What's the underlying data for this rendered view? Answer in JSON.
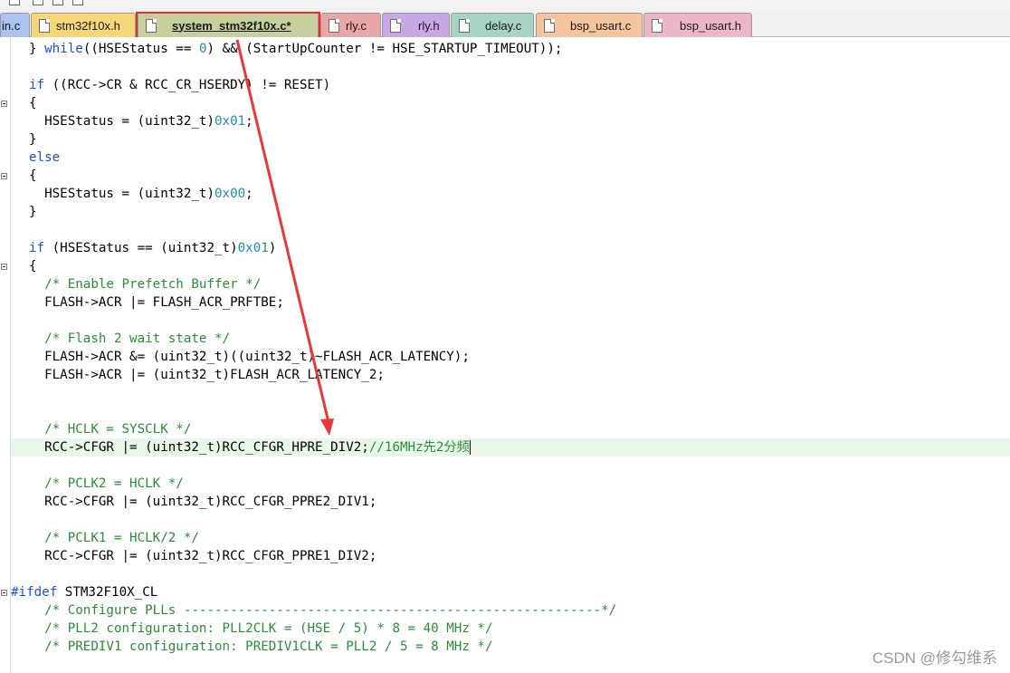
{
  "tabs": [
    {
      "label": "in.c",
      "color": "#a9c4f0",
      "active": false
    },
    {
      "label": "stm32f10x.h",
      "color": "#f6d777",
      "active": false
    },
    {
      "label": "system_stm32f10x.c*",
      "color": "#c9cf9c",
      "active": true
    },
    {
      "label": "rly.c",
      "color": "#e9a6a6",
      "active": false
    },
    {
      "label": "rly.h",
      "color": "#c9a6e6",
      "active": false
    },
    {
      "label": "delay.c",
      "color": "#a6d3c3",
      "active": false
    },
    {
      "label": "bsp_usart.c",
      "color": "#f6c49c",
      "active": false
    },
    {
      "label": "bsp_usart.h",
      "color": "#ecb6c6",
      "active": false
    }
  ],
  "editor": {
    "current_line_color": "#e8f8e8",
    "lines": [
      [
        {
          "t": "} "
        },
        {
          "t": "while",
          "c": "kw"
        },
        {
          "t": "((HSEStatus == "
        },
        {
          "t": "0",
          "c": "num"
        },
        {
          "t": ") && (StartUpCounter != HSE_STARTUP_TIMEOUT));"
        }
      ],
      [],
      [
        {
          "t": "if",
          "c": "kw"
        },
        {
          "t": " ((RCC->CR & RCC_CR_HSERDY) != RESET)"
        }
      ],
      [
        {
          "t": "{"
        }
      ],
      [
        {
          "t": "  HSEStatus = (uint32_t)"
        },
        {
          "t": "0x01",
          "c": "num"
        },
        {
          "t": ";"
        }
      ],
      [
        {
          "t": "}"
        }
      ],
      [
        {
          "t": "else",
          "c": "kw"
        }
      ],
      [
        {
          "t": "{"
        }
      ],
      [
        {
          "t": "  HSEStatus = (uint32_t)"
        },
        {
          "t": "0x00",
          "c": "num"
        },
        {
          "t": ";"
        }
      ],
      [
        {
          "t": "}"
        }
      ],
      [],
      [
        {
          "t": "if",
          "c": "kw"
        },
        {
          "t": " (HSEStatus == (uint32_t)"
        },
        {
          "t": "0x01",
          "c": "num"
        },
        {
          "t": ")"
        }
      ],
      [
        {
          "t": "{"
        }
      ],
      [
        {
          "t": "  "
        },
        {
          "t": "/* Enable Prefetch Buffer */",
          "c": "cm"
        }
      ],
      [
        {
          "t": "  FLASH->ACR |= FLASH_ACR_PRFTBE;"
        }
      ],
      [],
      [
        {
          "t": "  "
        },
        {
          "t": "/* Flash 2 wait state */",
          "c": "cm"
        }
      ],
      [
        {
          "t": "  FLASH->ACR &= (uint32_t)((uint32_t)~FLASH_ACR_LATENCY);"
        }
      ],
      [
        {
          "t": "  FLASH->ACR |= (uint32_t)FLASH_ACR_LATENCY_2;"
        }
      ],
      [],
      [],
      [
        {
          "t": "  "
        },
        {
          "t": "/* HCLK = SYSCLK */",
          "c": "cm"
        }
      ],
      [
        {
          "t": "  RCC->CFGR |= (uint32_t)RCC_CFGR_HPRE_DIV2;"
        },
        {
          "t": "//16MHz先2分频",
          "c": "cm"
        }
      ],
      [],
      [
        {
          "t": "  "
        },
        {
          "t": "/* PCLK2 = HCLK */",
          "c": "cm"
        }
      ],
      [
        {
          "t": "  RCC->CFGR |= (uint32_t)RCC_CFGR_PPRE2_DIV1;"
        }
      ],
      [],
      [
        {
          "t": "  "
        },
        {
          "t": "/* PCLK1 = HCLK/2 */",
          "c": "cm"
        }
      ],
      [
        {
          "t": "  RCC->CFGR |= (uint32_t)RCC_CFGR_PPRE1_DIV2;"
        }
      ],
      [],
      [
        {
          "t": "#ifdef",
          "c": "pp"
        },
        {
          "t": " STM32F10X_CL"
        }
      ],
      [
        {
          "t": "  "
        },
        {
          "t": "/* Configure PLLs ------------------------------------------------------*/",
          "c": "cm"
        }
      ],
      [
        {
          "t": "  "
        },
        {
          "t": "/* PLL2 configuration: PLL2CLK = (HSE / 5) * 8 = 40 MHz */",
          "c": "cm"
        }
      ],
      [
        {
          "t": "  "
        },
        {
          "t": "/* PREDIV1 configuration: PREDIV1CLK = PLL2 / 5 = 8 MHz */",
          "c": "cm"
        }
      ]
    ]
  },
  "watermark": "CSDN @修勾维系"
}
